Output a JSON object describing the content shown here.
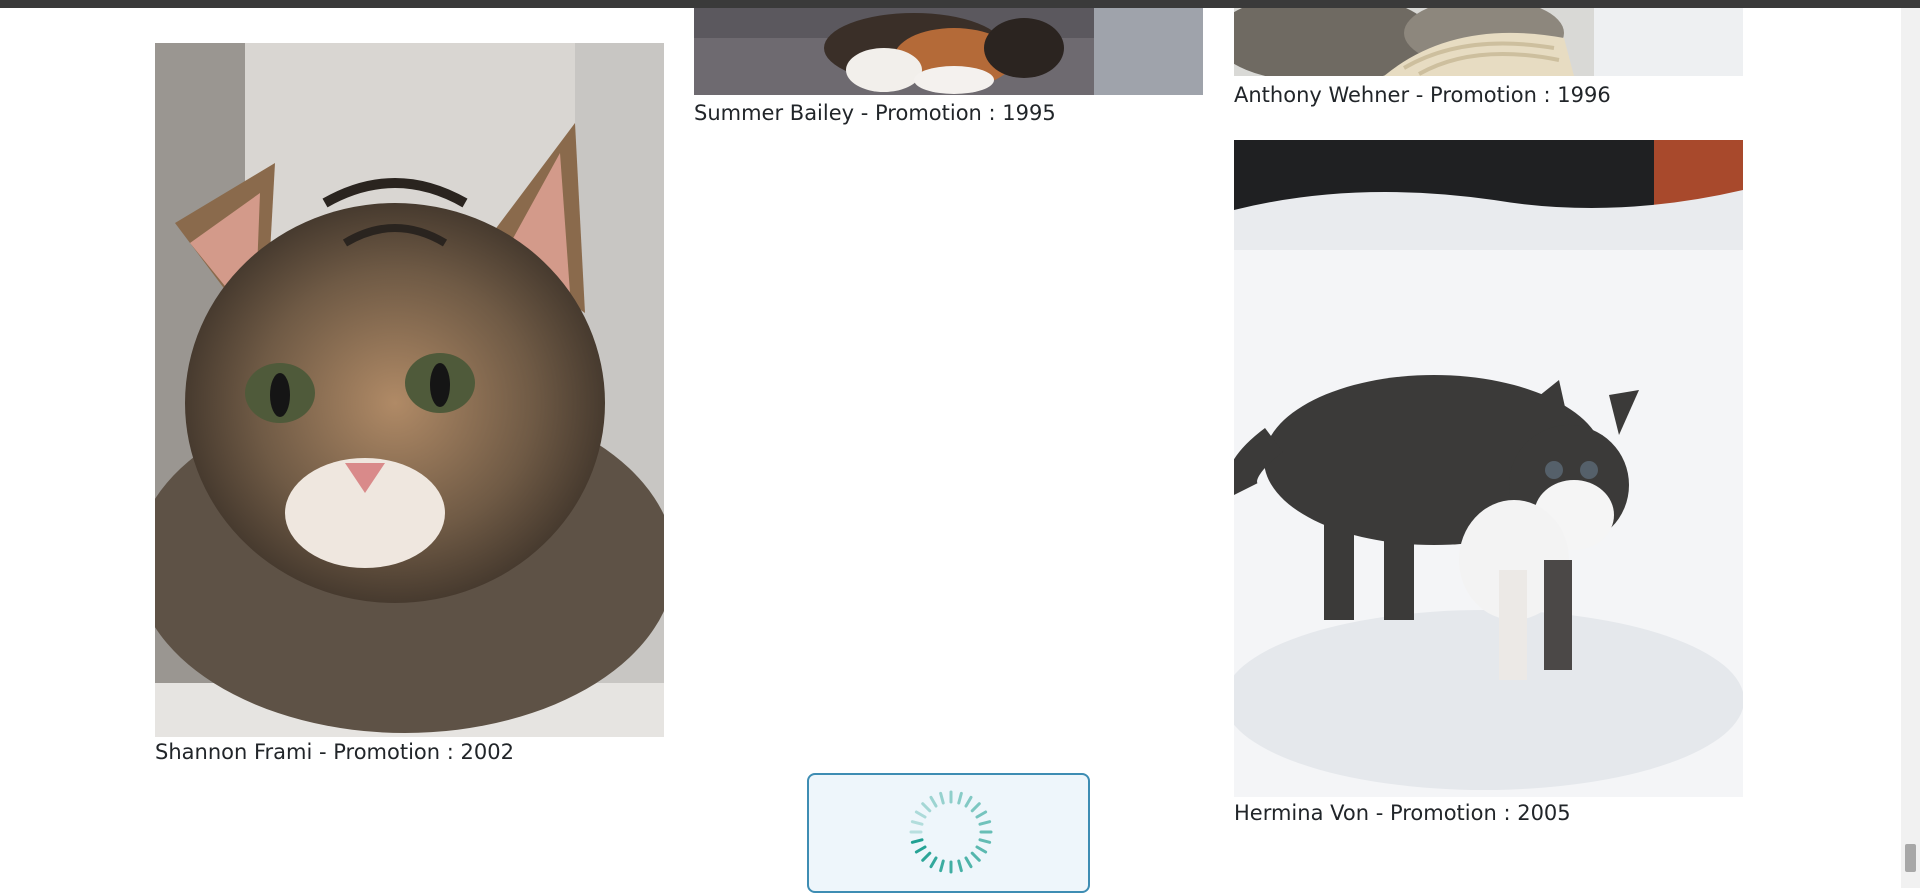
{
  "gallery": {
    "cards": [
      {
        "name": "Shannon Frami",
        "caption": "Shannon Frami - Promotion : 2002",
        "image": "tabby-kitten-closeup"
      },
      {
        "name": "Summer Bailey",
        "caption": "Summer Bailey - Promotion : 1995",
        "image": "calico-cat-paws-on-blanket"
      },
      {
        "name": "Anthony Wehner",
        "caption": "Anthony Wehner - Promotion : 1996",
        "image": "tabby-cat-with-yarn"
      },
      {
        "name": "Hermina Von",
        "caption": "Hermina Von - Promotion : 2005",
        "image": "kitten-in-snow"
      }
    ]
  },
  "loader": {
    "icon": "spinner-icon",
    "accent": "#1a9e8f",
    "border": "#3e8db3"
  },
  "colors": {
    "text": "#212529",
    "background": "#ffffff"
  }
}
